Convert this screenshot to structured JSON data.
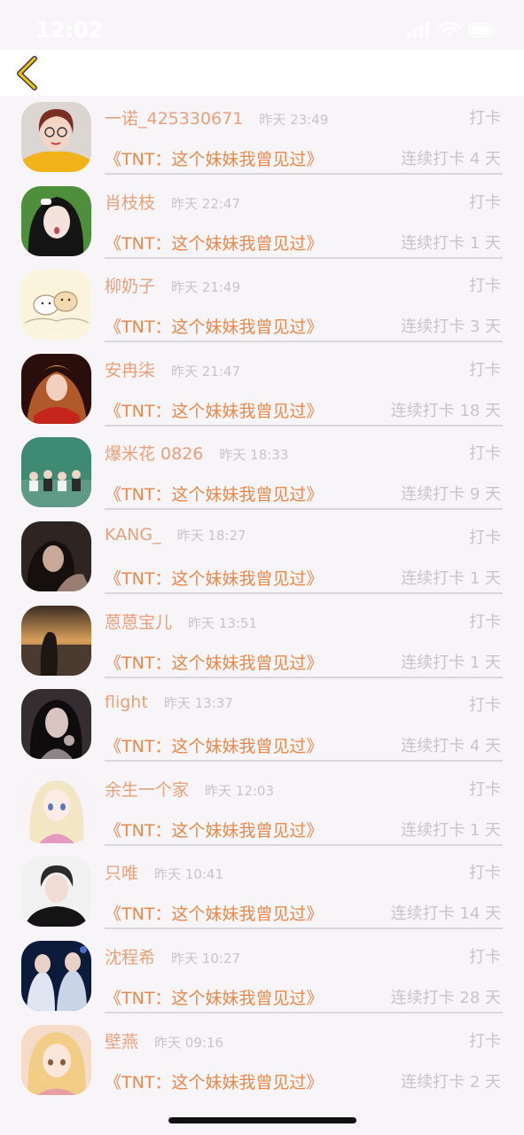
{
  "status": {
    "time": "12:02",
    "icons": [
      "signal-icon",
      "wifi-icon",
      "battery-icon"
    ]
  },
  "nav": {
    "back_icon": "chevron-left-icon",
    "accent": "#f0c419"
  },
  "colors": {
    "name": "#e6a07b",
    "book": "#e9884a",
    "muted": "#c9c3c6",
    "divider": "#d9d6d9"
  },
  "records": [
    {
      "name": "一诺_425330671",
      "time": "昨天 23:49",
      "action": "打卡",
      "book": "《TNT：这个妹妹我曾见过》",
      "streak": "连续打卡 4 天"
    },
    {
      "name": "肖枝枝",
      "time": "昨天 22:47",
      "action": "打卡",
      "book": "《TNT：这个妹妹我曾见过》",
      "streak": "连续打卡 1 天"
    },
    {
      "name": "柳奶子",
      "time": "昨天 21:49",
      "action": "打卡",
      "book": "《TNT：这个妹妹我曾见过》",
      "streak": "连续打卡 3 天"
    },
    {
      "name": "安冉柒",
      "time": "昨天 21:47",
      "action": "打卡",
      "book": "《TNT：这个妹妹我曾见过》",
      "streak": "连续打卡 18 天"
    },
    {
      "name": "爆米花 0826",
      "time": "昨天 18:33",
      "action": "打卡",
      "book": "《TNT：这个妹妹我曾见过》",
      "streak": "连续打卡 9 天"
    },
    {
      "name": "KANG_",
      "time": "昨天 18:27",
      "action": "打卡",
      "book": "《TNT：这个妹妹我曾见过》",
      "streak": "连续打卡 1 天"
    },
    {
      "name": "蒽蒽宝儿",
      "time": "昨天 13:51",
      "action": "打卡",
      "book": "《TNT：这个妹妹我曾见过》",
      "streak": "连续打卡 1 天"
    },
    {
      "name": "flight",
      "time": "昨天 13:37",
      "action": "打卡",
      "book": "《TNT：这个妹妹我曾见过》",
      "streak": "连续打卡 4 天"
    },
    {
      "name": "余生一个家",
      "time": "昨天 12:03",
      "action": "打卡",
      "book": "《TNT：这个妹妹我曾见过》",
      "streak": "连续打卡 1 天"
    },
    {
      "name": "只唯",
      "time": "昨天 10:41",
      "action": "打卡",
      "book": "《TNT：这个妹妹我曾见过》",
      "streak": "连续打卡 14 天"
    },
    {
      "name": "沈程希",
      "time": "昨天 10:27",
      "action": "打卡",
      "book": "《TNT：这个妹妹我曾见过》",
      "streak": "连续打卡 28 天"
    },
    {
      "name": "壁燕",
      "time": "昨天 09:16",
      "action": "打卡",
      "book": "《TNT：这个妹妹我曾见过》",
      "streak": "连续打卡 2 天"
    }
  ]
}
